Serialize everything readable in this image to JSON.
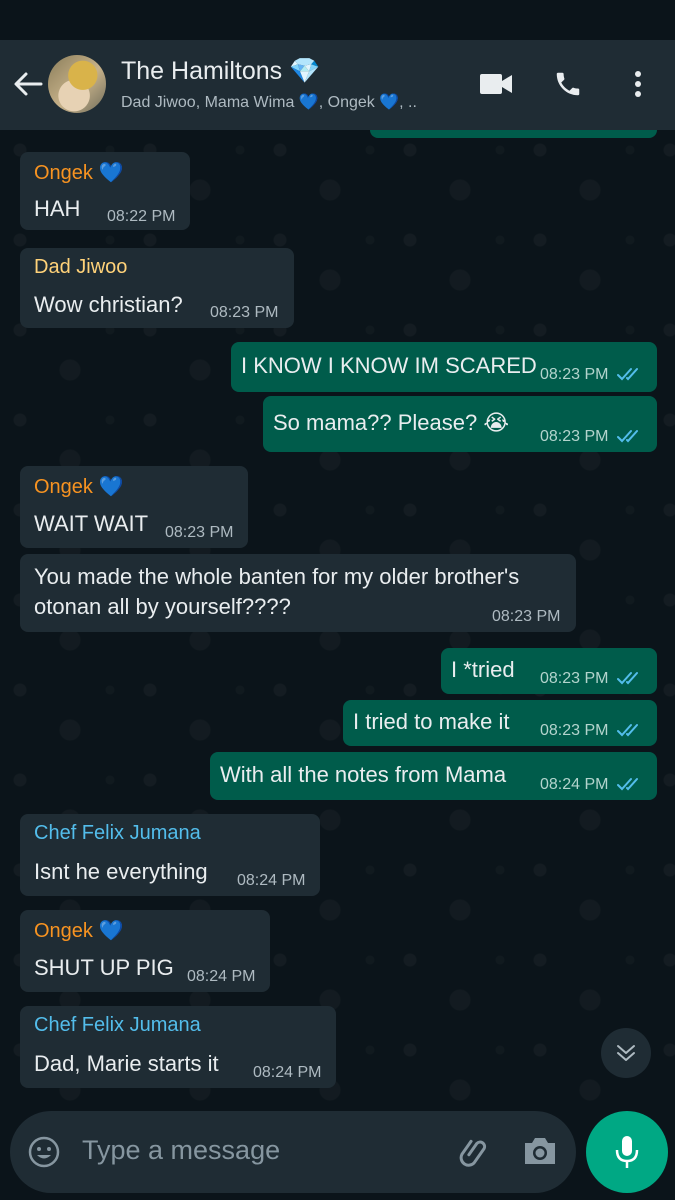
{
  "header": {
    "title": "The Hamiltons 💎",
    "subtitle": "Dad Jiwoo, Mama Wima 💙, Ongek 💙, .."
  },
  "messages": [
    {
      "type": "in",
      "sender": "Ongek 💙",
      "sender_color": "#f79321",
      "text": "HAH",
      "time": "08:22 PM"
    },
    {
      "type": "in",
      "sender": "Dad Jiwoo",
      "sender_color": "#ffd279",
      "text": "Wow christian?",
      "time": "08:23 PM"
    },
    {
      "type": "out",
      "text": "I KNOW I KNOW IM SCARED",
      "time": "08:23 PM"
    },
    {
      "type": "out",
      "text": "So mama?? Please? 😭",
      "time": "08:23 PM"
    },
    {
      "type": "in",
      "sender": "Ongek 💙",
      "sender_color": "#f79321",
      "text": "WAIT WAIT",
      "time": "08:23 PM"
    },
    {
      "type": "in",
      "text_lines": [
        "You made the whole banten for my older brother's",
        "otonan all by yourself????"
      ],
      "time": "08:23 PM"
    },
    {
      "type": "out",
      "text": "I *tried",
      "time": "08:23 PM"
    },
    {
      "type": "out",
      "text": "I tried to make it",
      "time": "08:23 PM"
    },
    {
      "type": "out",
      "text": "With all the notes from Mama",
      "time": "08:24 PM"
    },
    {
      "type": "in",
      "sender": "Chef Felix Jumana",
      "sender_color": "#53bdeb",
      "text": "Isnt he everything",
      "time": "08:24 PM"
    },
    {
      "type": "in",
      "sender": "Ongek 💙",
      "sender_color": "#f79321",
      "text": "SHUT UP PIG",
      "time": "08:24 PM"
    },
    {
      "type": "in",
      "sender": "Chef Felix Jumana",
      "sender_color": "#53bdeb",
      "text": "Dad, Marie starts it",
      "time": "08:24 PM"
    }
  ],
  "input": {
    "placeholder": "Type a message"
  },
  "colors": {
    "header_bg": "#1f2c34",
    "incoming_bubble": "#1f2c34",
    "outgoing_bubble": "#005c4b",
    "accent": "#00a884",
    "read_ticks": "#53bdeb"
  },
  "icons": {
    "back": "arrow-left-icon",
    "video": "video-camera-icon",
    "call": "phone-icon",
    "menu": "more-vertical-icon",
    "emoji": "emoji-icon",
    "attach": "paperclip-icon",
    "camera": "camera-icon",
    "mic": "microphone-icon",
    "scroll": "chevron-double-down-icon"
  }
}
